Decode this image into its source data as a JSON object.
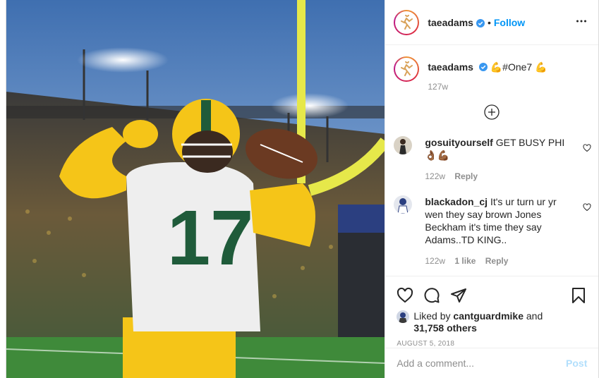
{
  "header": {
    "username": "taeadams",
    "separator": "•",
    "follow_label": "Follow"
  },
  "caption": {
    "username": "taeadams",
    "text": "💪#One7 💪",
    "age": "127w"
  },
  "comments": [
    {
      "username": "gosuityourself",
      "text": "GET BUSY PHI 👌🏾💪🏾",
      "age": "122w",
      "likes": "",
      "reply_label": "Reply"
    },
    {
      "username": "blackadon_cj",
      "text": "It's ur turn ur yr wen they say brown Jones Beckham it's time they say Adams..TD KING..",
      "age": "122w",
      "likes": "1 like",
      "reply_label": "Reply"
    }
  ],
  "likes": {
    "prefix": "Liked by",
    "liker": "cantguardmike",
    "joiner": "and",
    "others": "31,758 others"
  },
  "date": "AUGUST 5, 2018",
  "add_comment": {
    "placeholder": "Add a comment...",
    "post_label": "Post"
  },
  "icons": {
    "verified": "verified-badge-icon",
    "more": "more-options-icon",
    "load_more": "plus-circle-icon",
    "like": "heart-icon",
    "comment": "comment-icon",
    "share": "share-icon",
    "save": "bookmark-icon"
  },
  "colors": {
    "accent": "#0095f6",
    "muted": "#8e8e8e",
    "post_disabled": "#b2dffc",
    "jersey_green": "#1f5b3a",
    "jersey_gold": "#f5c518"
  }
}
